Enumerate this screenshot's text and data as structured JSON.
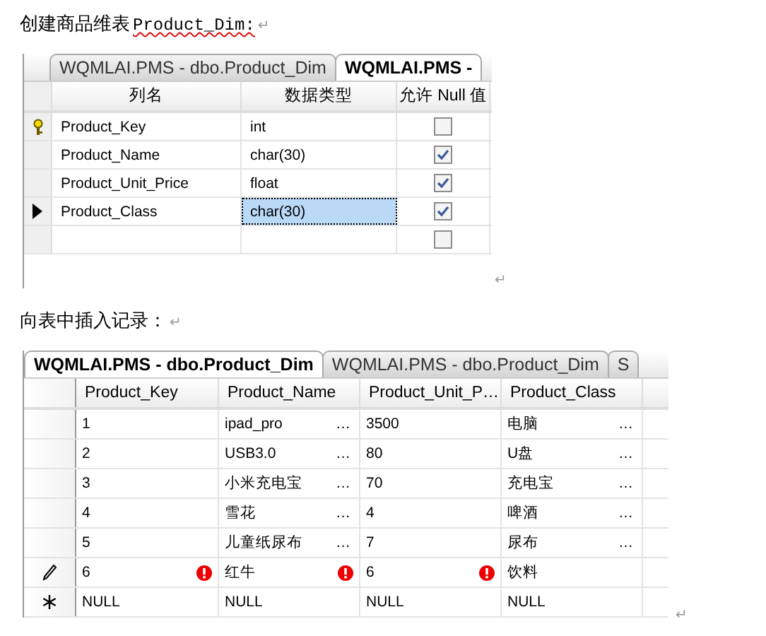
{
  "heading_1": {
    "text": "创建商品维表",
    "code": "Product_Dim:",
    "mark": "↵"
  },
  "design_table": {
    "tabs": [
      {
        "label": "WQMLAI.PMS - dbo.Product_Dim",
        "selected": false
      },
      {
        "label": "WQMLAI.PMS -",
        "selected": true
      }
    ],
    "columns": [
      "列名",
      "数据类型",
      "允许 Null 值"
    ],
    "rows": [
      {
        "kind": "key",
        "name": "Product_Key",
        "type": "int",
        "allow_null": false,
        "selected": false
      },
      {
        "kind": "plain",
        "name": "Product_Name",
        "type": "char(30)",
        "allow_null": true,
        "selected": false
      },
      {
        "kind": "plain",
        "name": "Product_Unit_Price",
        "type": "float",
        "allow_null": true,
        "selected": false
      },
      {
        "kind": "current",
        "name": "Product_Class",
        "type": "char(30)",
        "allow_null": true,
        "selected": true
      },
      {
        "kind": "plain",
        "allow_null": false,
        "selected": false
      }
    ],
    "mark": "↵"
  },
  "heading_2": {
    "text": "向表中插入记录：",
    "mark": "↵"
  },
  "data_table": {
    "tabs": [
      {
        "label": "WQMLAI.PMS - dbo.Product_Dim",
        "selected": true
      },
      {
        "label": "WQMLAI.PMS - dbo.Product_Dim",
        "selected": false
      },
      {
        "label": "S",
        "selected": false
      }
    ],
    "columns": [
      "Product_Key",
      "Product_Name",
      "Product_Unit_P…",
      "Product_Class"
    ],
    "rows": [
      {
        "kind": "plain",
        "cells": [
          {
            "text": "1"
          },
          {
            "text": "ipad_pro",
            "ellipsis": "…"
          },
          {
            "text": "3500"
          },
          {
            "text": "电脑",
            "ellipsis": "…"
          }
        ]
      },
      {
        "kind": "plain",
        "cells": [
          {
            "text": "2"
          },
          {
            "text": "USB3.0",
            "ellipsis": "…"
          },
          {
            "text": "80"
          },
          {
            "text": "U盘",
            "ellipsis": "…"
          }
        ]
      },
      {
        "kind": "plain",
        "cells": [
          {
            "text": "3"
          },
          {
            "text": "小米充电宝",
            "ellipsis": "…"
          },
          {
            "text": "70"
          },
          {
            "text": "充电宝",
            "ellipsis": "…"
          }
        ]
      },
      {
        "kind": "plain",
        "cells": [
          {
            "text": "4"
          },
          {
            "text": "雪花",
            "ellipsis": "…"
          },
          {
            "text": "4"
          },
          {
            "text": "啤酒",
            "ellipsis": "…"
          }
        ]
      },
      {
        "kind": "plain",
        "cells": [
          {
            "text": "5"
          },
          {
            "text": "儿童纸尿布",
            "ellipsis": "…"
          },
          {
            "text": "7"
          },
          {
            "text": "尿布",
            "ellipsis": "…"
          }
        ]
      },
      {
        "kind": "editing",
        "cells": [
          {
            "text": "6",
            "error": true
          },
          {
            "text": "红牛",
            "error": true
          },
          {
            "text": "6",
            "error": true
          },
          {
            "text": "饮料"
          }
        ]
      },
      {
        "kind": "new",
        "cells": [
          {
            "text": "NULL"
          },
          {
            "text": "NULL"
          },
          {
            "text": "NULL"
          },
          {
            "text": "NULL"
          }
        ]
      }
    ],
    "mark": "↵"
  }
}
